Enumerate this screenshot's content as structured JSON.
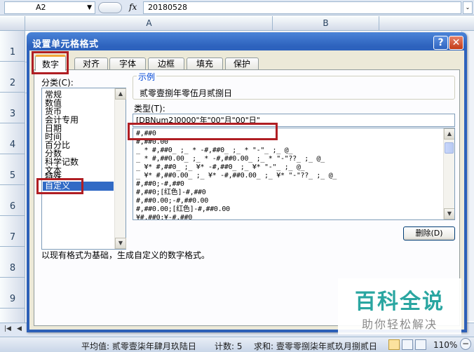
{
  "excel": {
    "name_box": "A2",
    "fx_label": "fx",
    "formula_value": "20180528",
    "columns": [
      "A",
      "B"
    ],
    "rows": [
      "1",
      "2",
      "3",
      "4",
      "5",
      "6",
      "7",
      "8",
      "9"
    ],
    "status": {
      "average": "平均值: 贰零壹柒年肆月玖陆日",
      "count": "计数: 5",
      "sum": "求和: 壹零零捌柒年贰玖月捌贰日",
      "zoom": "110%",
      "zoom_minus": "−"
    }
  },
  "dialog": {
    "title": "设置单元格格式",
    "help_label": "?",
    "close_label": "✕",
    "tabs": [
      "数字",
      "对齐",
      "字体",
      "边框",
      "填充",
      "保护"
    ],
    "category_label": "分类(C):",
    "categories": [
      "常规",
      "数值",
      "货币",
      "会计专用",
      "日期",
      "时间",
      "百分比",
      "分数",
      "科学记数",
      "文本",
      "特殊",
      "自定义"
    ],
    "selected_category": "自定义",
    "sample_label": "示例",
    "sample_value": "贰零壹捌年零伍月贰捌日",
    "type_label": "类型(T):",
    "type_value": "[DBNum2]0000\"年\"00\"月\"00\"日\"",
    "formats": [
      "#,##0",
      "#,##0.00",
      "_ * #,##0_ ;_ * -#,##0_ ;_ * \"-\"_ ;_ @_",
      "_ * #,##0.00_ ;_ * -#,##0.00_ ;_ * \"-\"??_ ;_ @_",
      "_ ¥* #,##0_ ;_ ¥* -#,##0_ ;_ ¥* \"-\"_ ;_ @_",
      "_ ¥* #,##0.00_ ;_ ¥* -#,##0.00_ ;_ ¥* \"-\"??_ ;_ @_",
      "#,##0;-#,##0",
      "#,##0;[红色]-#,##0",
      "#,##0.00;-#,##0.00",
      "#,##0.00;[红色]-#,##0.00",
      "¥#,##0;¥-#,##0"
    ],
    "delete_label": "删除(D)",
    "description": "以现有格式为基础，生成自定义的数字格式。"
  },
  "watermark": {
    "main": "百科全说",
    "sub": "助你轻松解决"
  }
}
